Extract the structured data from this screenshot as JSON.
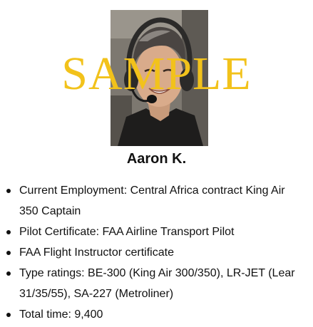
{
  "profile": {
    "name": "Aaron K.",
    "photo": "pilot-headset-photo",
    "watermark": "SAMPLE",
    "watermark_color": "#f2c21b"
  },
  "facts": [
    "Current Employment: Central Africa contract King Air 350 Captain",
    "Pilot Certificate: FAA Airline Transport Pilot",
    "FAA Flight Instructor certificate",
    "Type ratings: BE-300 (King Air 300/350), LR-JET (Lear 31/35/55), SA-227 (Metroliner)",
    "Total time: 9,400"
  ]
}
